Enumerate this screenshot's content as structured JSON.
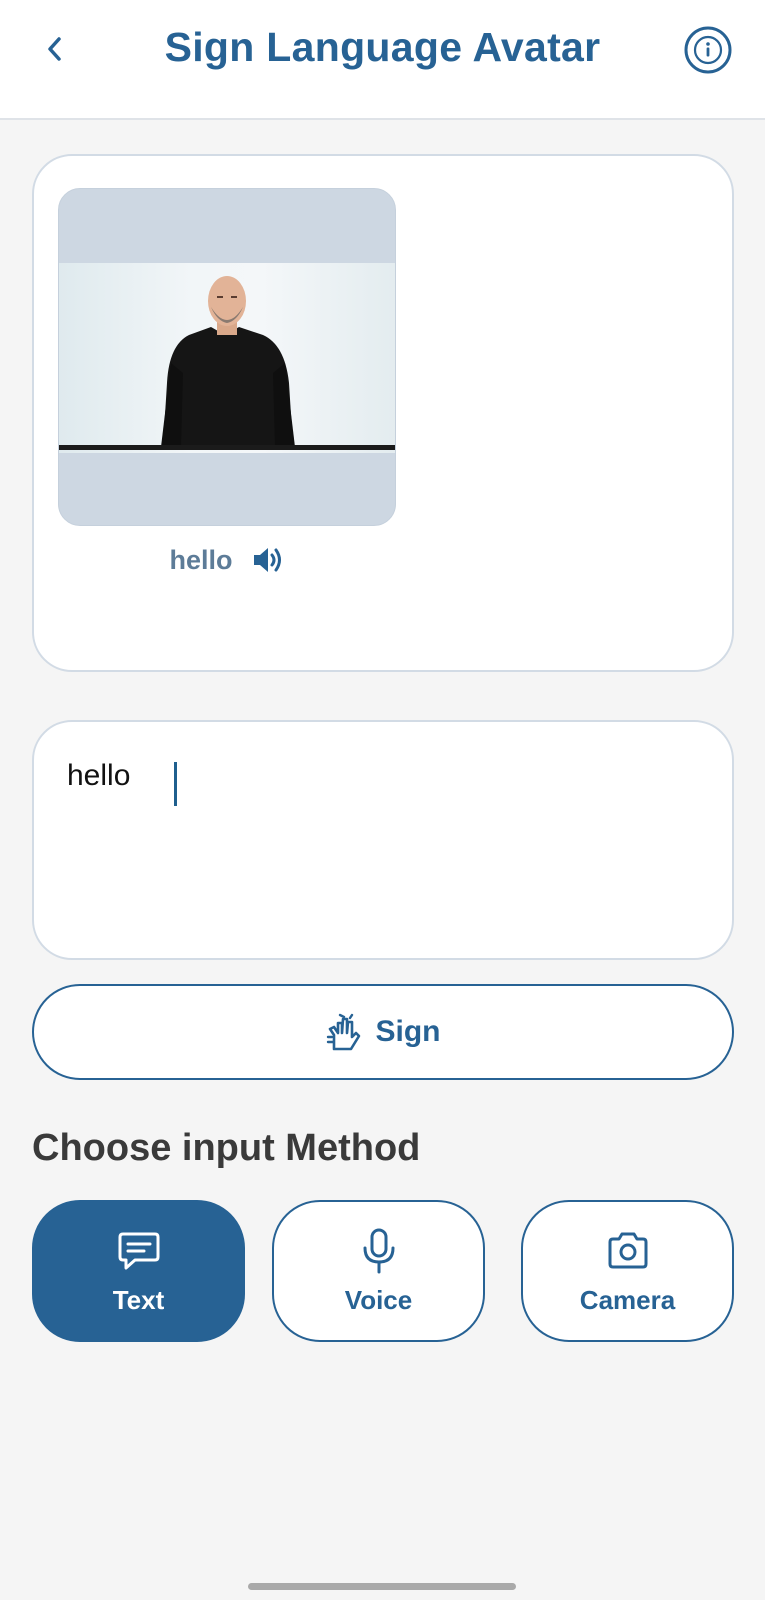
{
  "header": {
    "title": "Sign Language Avatar",
    "back_icon": "chevron-left-icon",
    "info_icon": "info-icon"
  },
  "avatar_card": {
    "word": "hello",
    "speaker_icon": "volume-icon"
  },
  "input": {
    "value": "hello"
  },
  "sign_button": {
    "label": "Sign",
    "icon": "hands-signing-icon"
  },
  "methods": {
    "title": "Choose input Method",
    "items": [
      {
        "label": "Text",
        "icon": "chat-message-icon",
        "selected": true
      },
      {
        "label": "Voice",
        "icon": "microphone-icon",
        "selected": false
      },
      {
        "label": "Camera",
        "icon": "camera-icon",
        "selected": false
      }
    ]
  },
  "colors": {
    "primary": "#276294",
    "background": "#f5f5f5",
    "card": "#ffffff",
    "card_border": "#d2dbe5"
  }
}
